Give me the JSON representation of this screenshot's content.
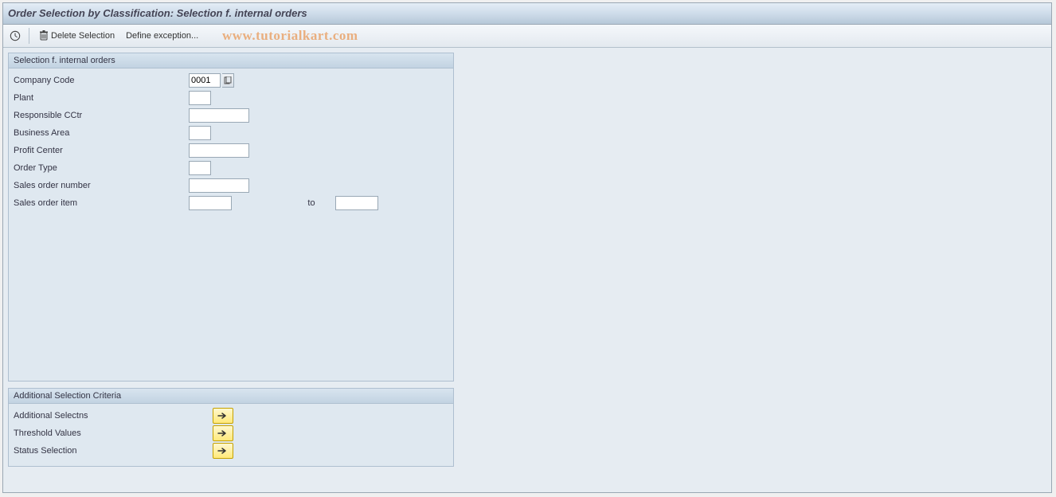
{
  "title": "Order Selection by Classification: Selection f. internal orders",
  "toolbar": {
    "delete_selection": "Delete Selection",
    "define_exception": "Define exception..."
  },
  "watermark": "www.tutorialkart.com",
  "group_selection": {
    "title": "Selection f. internal orders",
    "fields": {
      "company_code": {
        "label": "Company Code",
        "value": "0001"
      },
      "plant": {
        "label": "Plant",
        "value": ""
      },
      "responsible_cctr": {
        "label": "Responsible CCtr",
        "value": ""
      },
      "business_area": {
        "label": "Business Area",
        "value": ""
      },
      "profit_center": {
        "label": "Profit Center",
        "value": ""
      },
      "order_type": {
        "label": "Order Type",
        "value": ""
      },
      "sales_order_number": {
        "label": "Sales order number",
        "value": ""
      },
      "sales_order_item": {
        "label": "Sales order item",
        "value": "",
        "to_label": "to",
        "to_value": ""
      }
    }
  },
  "group_additional": {
    "title": "Additional Selection Criteria",
    "rows": {
      "additional_selectns": "Additional Selectns",
      "threshold_values": "Threshold Values",
      "status_selection": "Status Selection"
    }
  }
}
